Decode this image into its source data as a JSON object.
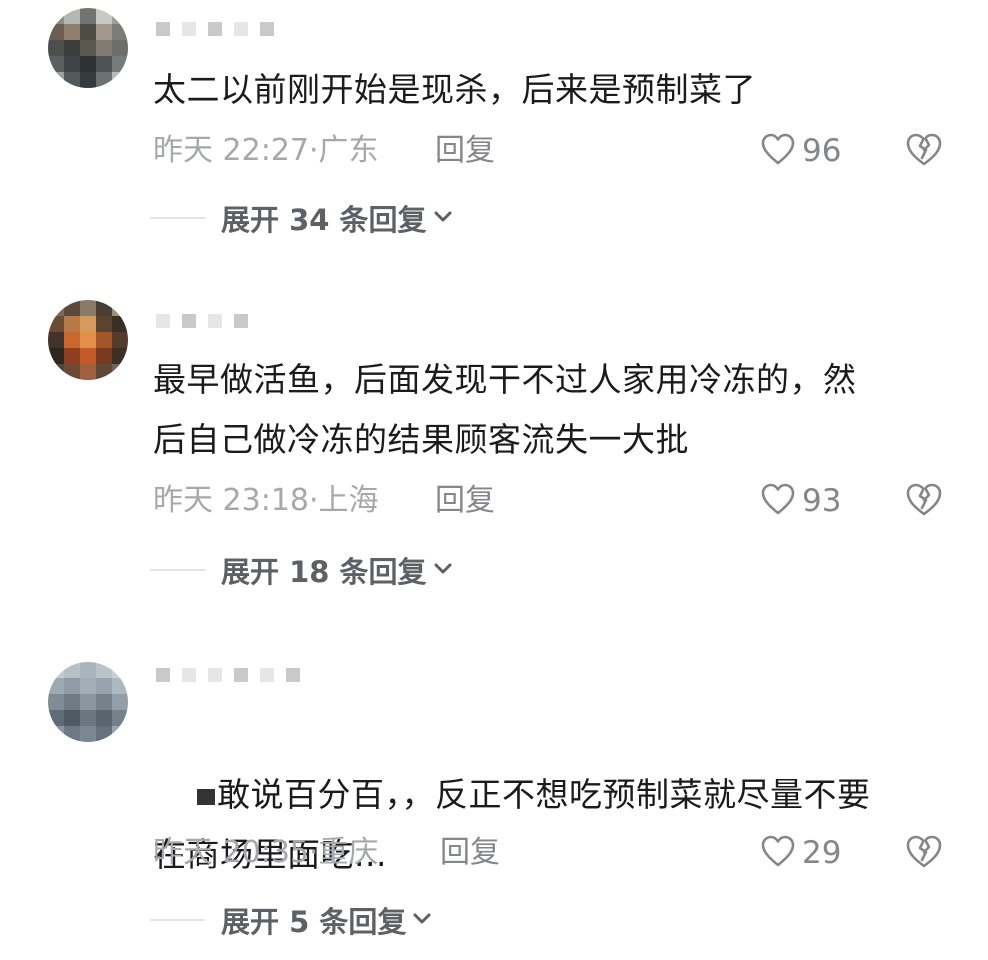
{
  "comments": [
    {
      "text": "太二以前刚开始是现杀，后来是预制菜了",
      "time": "昨天 22:27",
      "location": "广东",
      "reply_label": "回复",
      "likes": "96",
      "expand_label": "展开 34 条回复"
    },
    {
      "text": "最早做活鱼，后面发现干不过人家用冷冻的，然\n后自己做冷冻的结果顾客流失一大批",
      "time": "昨天 23:18",
      "location": "上海",
      "reply_label": "回复",
      "likes": "93",
      "expand_label": "展开 18 条回复"
    },
    {
      "text": "敢说百分百，，反正不想吃预制菜就尽量不要\n在商场里面吃...",
      "time": "昨天 20:35",
      "location": "重庆",
      "reply_label": "回复",
      "likes": "29",
      "expand_label": "展开 5 条回复"
    }
  ],
  "icons": {
    "like": "heart-outline-icon",
    "dislike": "broken-heart-icon",
    "expand": "chevron-down-icon"
  },
  "colors": {
    "text_primary": "#1b1b1b",
    "text_meta": "#a7a8ad",
    "text_action": "#85868b"
  }
}
